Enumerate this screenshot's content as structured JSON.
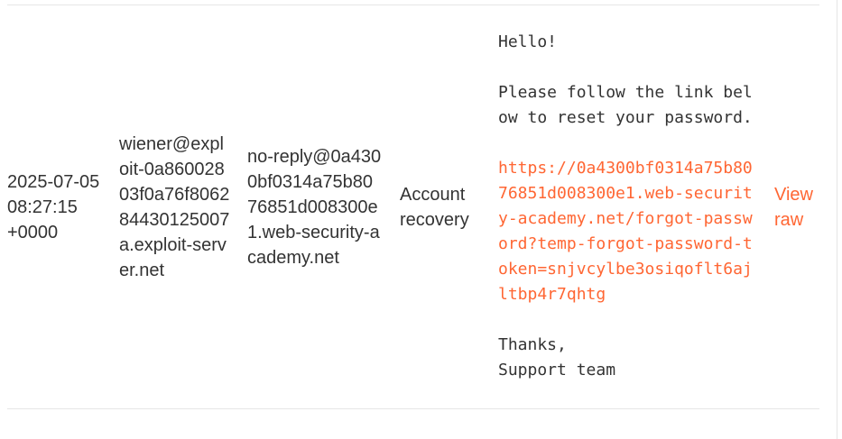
{
  "email": {
    "date": "2025-07-05 08:27:15 +0000",
    "to": "wiener@exploit-0a86002803f0a76f806284430125007a.exploit-server.net",
    "from": "no-reply@0a4300bf0314a75b8076851d008300e1.web-security-academy.net",
    "subject": "Account recovery",
    "body_greeting": "Hello!",
    "body_text": "Please follow the link below to reset your password.",
    "body_link": "https://0a4300bf0314a75b8076851d008300e1.web-security-academy.net/forgot-password?temp-forgot-password-token=snjvcylbe3osiqoflt6ajltbp4r7qhtg",
    "body_signoff": "Thanks,",
    "body_signature": "Support team",
    "view_raw_label": "View raw"
  },
  "colors": {
    "link": "#ff6633",
    "text": "#333333",
    "border": "#e6e6e6"
  }
}
